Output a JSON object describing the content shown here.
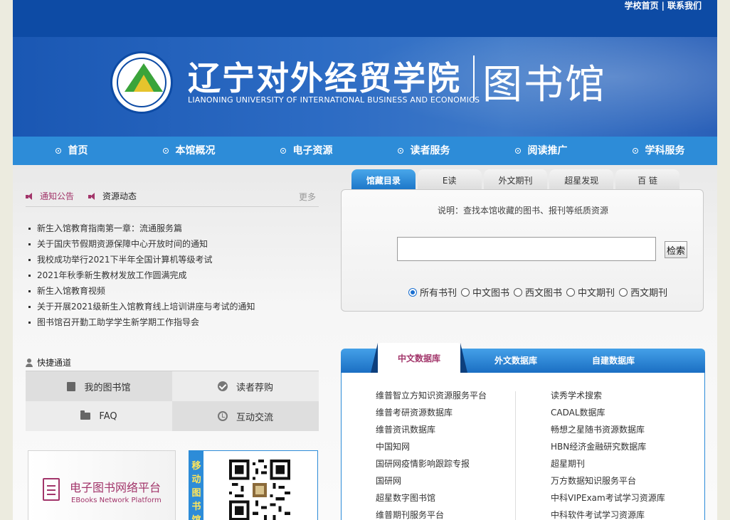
{
  "top_links": {
    "home": "学校首页",
    "separator": "|",
    "contact": "联系我们"
  },
  "banner": {
    "school_cn": "辽宁对外经贸学院",
    "school_en": "LIANONING UNIVERSITY OF INTERNATIONAL BUSINESS AND ECONOMICS",
    "library_cn": "图书馆"
  },
  "nav": [
    {
      "label": "首页"
    },
    {
      "label": "本馆概况"
    },
    {
      "label": "电子资源"
    },
    {
      "label": "读者服务"
    },
    {
      "label": "阅读推广"
    },
    {
      "label": "学科服务"
    }
  ],
  "notices": {
    "tab1": "通知公告",
    "tab2": "资源动态",
    "more": "更多",
    "items": [
      "新生入馆教育指南第一章：流通服务篇",
      "关于国庆节假期资源保障中心开放时间的通知",
      "我校成功举行2021下半年全国计算机等级考试",
      "2021年秋季新生教材发放工作圆满完成",
      "新生入馆教育视频",
      "关于开展2021级新生入馆教育线上培训讲座与考试的通知",
      "图书馆召开勤工助学学生新学期工作指导会"
    ]
  },
  "quick": {
    "title": "快捷通道",
    "items": [
      "我的图书馆",
      "读者荐购",
      "FAQ",
      "互动交流"
    ]
  },
  "ebook": {
    "title": "电子图书网络平台",
    "subtitle": "EBooks Network Platform"
  },
  "mobile": {
    "label": "移动图书馆"
  },
  "search": {
    "tabs": [
      "馆藏目录",
      "E读",
      "外文期刊",
      "超星发现",
      "百 链"
    ],
    "hint": "说明：查找本馆收藏的图书、报刊等纸质资源",
    "input_value": "",
    "button": "检索",
    "options": [
      "所有书刊",
      "中文图书",
      "西文图书",
      "中文期刊",
      "西文期刊"
    ]
  },
  "databases": {
    "tabs": [
      "中文数据库",
      "外文数据库",
      "自建数据库"
    ],
    "left": [
      "维普智立方知识资源服务平台",
      "维普考研资源数据库",
      "维普资讯数据库",
      "中国知网",
      "国研网疫情影响跟踪专报",
      "国研网",
      "超星数字图书馆",
      "维普期刊服务平台"
    ],
    "right": [
      "读秀学术搜索",
      "CADAL数据库",
      "畅想之星随书资源数据库",
      "HBN经济金融研究数据库",
      "超星期刊",
      "万方数据知识服务平台",
      "中科VIPExam考试学习资源库",
      "中科软件考试学习资源库"
    ]
  },
  "colors": {
    "brand_blue": "#0d4ba5",
    "nav_blue": "#2d8cd8",
    "accent_magenta": "#a2356a"
  }
}
